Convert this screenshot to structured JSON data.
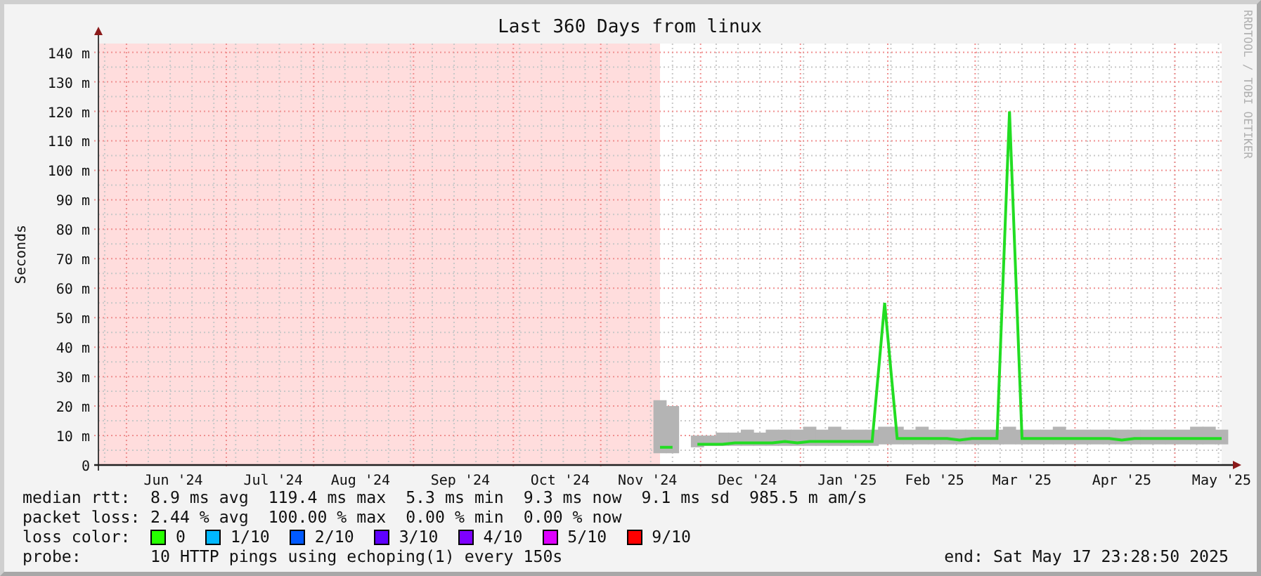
{
  "graph": {
    "title": "Last 360 Days from linux",
    "credit": "RRDTOOL / TOBI OETIKER",
    "chart_data": {
      "type": "line",
      "ylabel": "Seconds",
      "grid": true,
      "ylim": [
        0,
        143
      ],
      "categories": [
        null,
        null,
        null,
        null,
        null,
        null,
        "Jun '24",
        null,
        null,
        null,
        null,
        null,
        null,
        null,
        "Jul '24",
        null,
        null,
        null,
        null,
        null,
        null,
        "Aug '24",
        null,
        null,
        null,
        null,
        null,
        null,
        null,
        "Sep '24",
        null,
        null,
        null,
        null,
        null,
        null,
        null,
        "Oct '24",
        null,
        null,
        null,
        null,
        null,
        null,
        "Nov '24",
        null,
        null,
        null,
        null,
        null,
        null,
        null,
        "Dec '24",
        null,
        null,
        null,
        null,
        null,
        null,
        null,
        "Jan '25",
        null,
        null,
        null,
        null,
        null,
        null,
        "Feb '25",
        null,
        null,
        null,
        null,
        null,
        null,
        "Mar '25",
        null,
        null,
        null,
        null,
        null,
        null,
        null,
        "Apr '25",
        null,
        null,
        null,
        null,
        null,
        null,
        null,
        "May '25"
      ],
      "series": [
        {
          "name": "median rtt:",
          "color": "#22dd22",
          "values": [
            null,
            null,
            null,
            null,
            null,
            null,
            null,
            null,
            null,
            null,
            null,
            null,
            null,
            null,
            null,
            null,
            null,
            null,
            null,
            null,
            null,
            null,
            null,
            null,
            null,
            null,
            null,
            null,
            null,
            null,
            null,
            null,
            null,
            null,
            null,
            null,
            null,
            null,
            null,
            null,
            null,
            null,
            null,
            null,
            null,
            6,
            6,
            null,
            7,
            7,
            7,
            7.5,
            7.5,
            7.5,
            7.5,
            8,
            7.5,
            8,
            8,
            8,
            8,
            8,
            8,
            55,
            9,
            9,
            9,
            9,
            9,
            8.5,
            9,
            9,
            9,
            120,
            9,
            9,
            9,
            9,
            9,
            9,
            9,
            9,
            8.5,
            9,
            9,
            9,
            9,
            9,
            9,
            9,
            9
          ],
          "errors": [
            null,
            null,
            null,
            null,
            null,
            null,
            null,
            null,
            null,
            null,
            null,
            null,
            null,
            null,
            null,
            null,
            null,
            null,
            null,
            null,
            null,
            null,
            null,
            null,
            null,
            null,
            null,
            null,
            null,
            null,
            null,
            null,
            null,
            null,
            null,
            null,
            null,
            null,
            null,
            null,
            null,
            null,
            null,
            null,
            null,
            [
              4,
              22
            ],
            [
              4,
              20
            ],
            null,
            [
              6,
              10
            ],
            [
              6.5,
              10
            ],
            [
              6.5,
              11
            ],
            [
              6.5,
              11
            ],
            [
              6.5,
              12
            ],
            [
              6.5,
              11
            ],
            [
              6.5,
              12
            ],
            [
              6.5,
              12
            ],
            [
              6.5,
              12
            ],
            [
              6.5,
              13
            ],
            [
              6.5,
              12
            ],
            [
              6.5,
              13
            ],
            [
              6.5,
              12
            ],
            [
              6.5,
              12
            ],
            [
              6.5,
              12
            ],
            [
              7,
              13
            ],
            [
              7,
              13
            ],
            [
              7,
              12
            ],
            [
              7,
              13
            ],
            [
              7,
              12
            ],
            [
              7,
              12
            ],
            [
              7,
              12
            ],
            [
              7,
              12
            ],
            [
              7,
              12
            ],
            [
              7,
              12
            ],
            [
              7,
              13
            ],
            [
              7,
              12
            ],
            [
              7,
              12
            ],
            [
              7,
              12
            ],
            [
              7,
              13
            ],
            [
              7,
              12
            ],
            [
              7,
              12
            ],
            [
              7,
              12
            ],
            [
              7,
              12
            ],
            [
              7,
              12
            ],
            [
              7,
              12
            ],
            [
              7,
              12
            ],
            [
              7,
              12
            ],
            [
              7,
              12
            ],
            [
              7,
              12
            ],
            [
              7,
              13
            ],
            [
              7,
              13
            ],
            [
              7,
              12
            ]
          ]
        }
      ],
      "yticks": [
        {
          "value": 0,
          "label": "0"
        },
        {
          "value": 10,
          "label": "10 m"
        },
        {
          "value": 20,
          "label": "20 m"
        },
        {
          "value": 30,
          "label": "30 m"
        },
        {
          "value": 40,
          "label": "40 m"
        },
        {
          "value": 50,
          "label": "50 m"
        },
        {
          "value": 60,
          "label": "60 m"
        },
        {
          "value": 70,
          "label": "70 m"
        },
        {
          "value": 80,
          "label": "80 m"
        },
        {
          "value": 90,
          "label": "90 m"
        },
        {
          "value": 100,
          "label": "100 m"
        },
        {
          "value": 110,
          "label": "110 m"
        },
        {
          "value": 120,
          "label": "120 m"
        },
        {
          "value": 130,
          "label": "130 m"
        },
        {
          "value": 140,
          "label": "140 m"
        }
      ]
    }
  },
  "stats": [
    {
      "values": [
        "8.9 ms avg",
        "119.4 ms max",
        "5.3 ms min",
        "9.3 ms now",
        "9.1 ms sd",
        "985.5 m am/s"
      ]
    },
    {
      "label": "packet loss:",
      "values": [
        "2.44 % avg",
        "100.00 % max",
        "0.00 % min",
        "0.00 % now"
      ]
    }
  ],
  "loss_color": {
    "label": "loss color:",
    "items": [
      {
        "label": "0",
        "color": "#26ff00"
      },
      {
        "label": "1/10",
        "color": "#00b8ff"
      },
      {
        "label": "2/10",
        "color": "#0059ff"
      },
      {
        "label": "3/10",
        "color": "#5e00ff"
      },
      {
        "label": "4/10",
        "color": "#7e00ff"
      },
      {
        "label": "5/10",
        "color": "#dd00ff"
      },
      {
        "label": "9/10",
        "color": "#ff0000"
      }
    ]
  },
  "probe": {
    "label": "probe:",
    "text": "10 HTTP pings using echoping(1) every 150s"
  },
  "end": "end: Sat May 17 23:28:50 2025"
}
